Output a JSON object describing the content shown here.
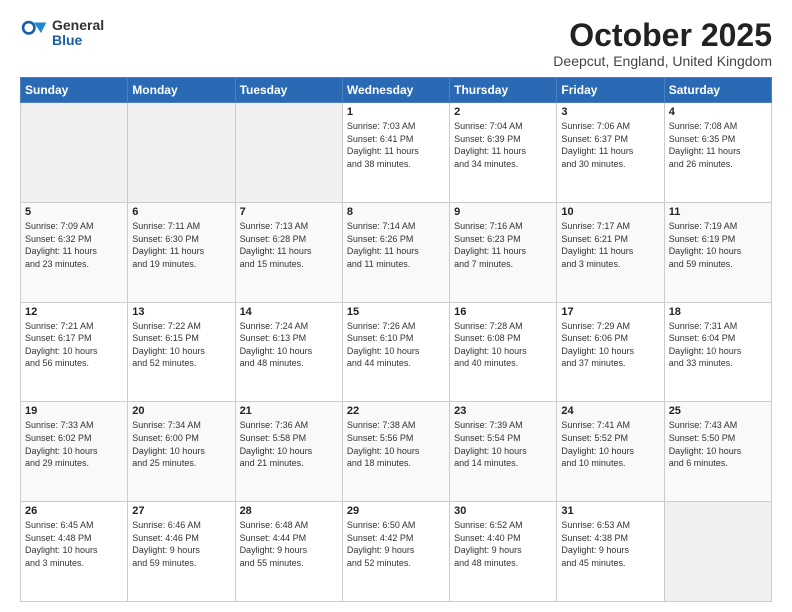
{
  "logo": {
    "general": "General",
    "blue": "Blue"
  },
  "title": {
    "month": "October 2025",
    "location": "Deepcut, England, United Kingdom"
  },
  "weekdays": [
    "Sunday",
    "Monday",
    "Tuesday",
    "Wednesday",
    "Thursday",
    "Friday",
    "Saturday"
  ],
  "weeks": [
    [
      {
        "day": "",
        "text": ""
      },
      {
        "day": "",
        "text": ""
      },
      {
        "day": "",
        "text": ""
      },
      {
        "day": "1",
        "text": "Sunrise: 7:03 AM\nSunset: 6:41 PM\nDaylight: 11 hours\nand 38 minutes."
      },
      {
        "day": "2",
        "text": "Sunrise: 7:04 AM\nSunset: 6:39 PM\nDaylight: 11 hours\nand 34 minutes."
      },
      {
        "day": "3",
        "text": "Sunrise: 7:06 AM\nSunset: 6:37 PM\nDaylight: 11 hours\nand 30 minutes."
      },
      {
        "day": "4",
        "text": "Sunrise: 7:08 AM\nSunset: 6:35 PM\nDaylight: 11 hours\nand 26 minutes."
      }
    ],
    [
      {
        "day": "5",
        "text": "Sunrise: 7:09 AM\nSunset: 6:32 PM\nDaylight: 11 hours\nand 23 minutes."
      },
      {
        "day": "6",
        "text": "Sunrise: 7:11 AM\nSunset: 6:30 PM\nDaylight: 11 hours\nand 19 minutes."
      },
      {
        "day": "7",
        "text": "Sunrise: 7:13 AM\nSunset: 6:28 PM\nDaylight: 11 hours\nand 15 minutes."
      },
      {
        "day": "8",
        "text": "Sunrise: 7:14 AM\nSunset: 6:26 PM\nDaylight: 11 hours\nand 11 minutes."
      },
      {
        "day": "9",
        "text": "Sunrise: 7:16 AM\nSunset: 6:23 PM\nDaylight: 11 hours\nand 7 minutes."
      },
      {
        "day": "10",
        "text": "Sunrise: 7:17 AM\nSunset: 6:21 PM\nDaylight: 11 hours\nand 3 minutes."
      },
      {
        "day": "11",
        "text": "Sunrise: 7:19 AM\nSunset: 6:19 PM\nDaylight: 10 hours\nand 59 minutes."
      }
    ],
    [
      {
        "day": "12",
        "text": "Sunrise: 7:21 AM\nSunset: 6:17 PM\nDaylight: 10 hours\nand 56 minutes."
      },
      {
        "day": "13",
        "text": "Sunrise: 7:22 AM\nSunset: 6:15 PM\nDaylight: 10 hours\nand 52 minutes."
      },
      {
        "day": "14",
        "text": "Sunrise: 7:24 AM\nSunset: 6:13 PM\nDaylight: 10 hours\nand 48 minutes."
      },
      {
        "day": "15",
        "text": "Sunrise: 7:26 AM\nSunset: 6:10 PM\nDaylight: 10 hours\nand 44 minutes."
      },
      {
        "day": "16",
        "text": "Sunrise: 7:28 AM\nSunset: 6:08 PM\nDaylight: 10 hours\nand 40 minutes."
      },
      {
        "day": "17",
        "text": "Sunrise: 7:29 AM\nSunset: 6:06 PM\nDaylight: 10 hours\nand 37 minutes."
      },
      {
        "day": "18",
        "text": "Sunrise: 7:31 AM\nSunset: 6:04 PM\nDaylight: 10 hours\nand 33 minutes."
      }
    ],
    [
      {
        "day": "19",
        "text": "Sunrise: 7:33 AM\nSunset: 6:02 PM\nDaylight: 10 hours\nand 29 minutes."
      },
      {
        "day": "20",
        "text": "Sunrise: 7:34 AM\nSunset: 6:00 PM\nDaylight: 10 hours\nand 25 minutes."
      },
      {
        "day": "21",
        "text": "Sunrise: 7:36 AM\nSunset: 5:58 PM\nDaylight: 10 hours\nand 21 minutes."
      },
      {
        "day": "22",
        "text": "Sunrise: 7:38 AM\nSunset: 5:56 PM\nDaylight: 10 hours\nand 18 minutes."
      },
      {
        "day": "23",
        "text": "Sunrise: 7:39 AM\nSunset: 5:54 PM\nDaylight: 10 hours\nand 14 minutes."
      },
      {
        "day": "24",
        "text": "Sunrise: 7:41 AM\nSunset: 5:52 PM\nDaylight: 10 hours\nand 10 minutes."
      },
      {
        "day": "25",
        "text": "Sunrise: 7:43 AM\nSunset: 5:50 PM\nDaylight: 10 hours\nand 6 minutes."
      }
    ],
    [
      {
        "day": "26",
        "text": "Sunrise: 6:45 AM\nSunset: 4:48 PM\nDaylight: 10 hours\nand 3 minutes."
      },
      {
        "day": "27",
        "text": "Sunrise: 6:46 AM\nSunset: 4:46 PM\nDaylight: 9 hours\nand 59 minutes."
      },
      {
        "day": "28",
        "text": "Sunrise: 6:48 AM\nSunset: 4:44 PM\nDaylight: 9 hours\nand 55 minutes."
      },
      {
        "day": "29",
        "text": "Sunrise: 6:50 AM\nSunset: 4:42 PM\nDaylight: 9 hours\nand 52 minutes."
      },
      {
        "day": "30",
        "text": "Sunrise: 6:52 AM\nSunset: 4:40 PM\nDaylight: 9 hours\nand 48 minutes."
      },
      {
        "day": "31",
        "text": "Sunrise: 6:53 AM\nSunset: 4:38 PM\nDaylight: 9 hours\nand 45 minutes."
      },
      {
        "day": "",
        "text": ""
      }
    ]
  ]
}
